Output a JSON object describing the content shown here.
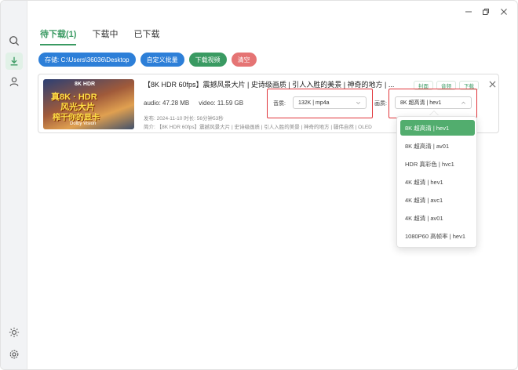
{
  "window_controls": {
    "minimize": "minimize",
    "maximize": "maximize",
    "close": "close"
  },
  "sidebar": {
    "items": [
      {
        "name": "search-icon"
      },
      {
        "name": "download-icon",
        "active": true
      },
      {
        "name": "user-icon"
      },
      {
        "name": "sun-icon"
      },
      {
        "name": "gear-icon"
      }
    ]
  },
  "tabs": [
    {
      "label": "待下载(1)",
      "active": true
    },
    {
      "label": "下载中",
      "active": false
    },
    {
      "label": "已下载",
      "active": false
    }
  ],
  "toolbar": {
    "storage_label": "存储: C:\\Users\\36036\\Desktop",
    "custom_batch_label": "自定义批量",
    "download_video_label": "下载视频",
    "clear_label": "清空"
  },
  "video": {
    "thumb_text_top": "8K HDR",
    "thumb_line1": "真8K · HDR",
    "thumb_line2": "风光大片",
    "thumb_line3": "榨干你的显卡",
    "thumb_brand": "Dolby Vision",
    "title": "【8K HDR 60fps】震撼风景大片 | 史诗级画质 | 引人入胜的美景 | 神奇的地方 | ...",
    "audio_size": "audio: 47.28 MB",
    "video_size": "video: 11.59 GB",
    "published": "发布: 2024-11-10 时长: 56分钟53秒",
    "intro": "简介: 【8K HDR 60fps】震撼风景大片 | 史诗级画质 | 引人入胜的美景 | 神奇的地方 | 疆伟自然 | OLED",
    "cover_btn": "封面",
    "audio_btn": "音频",
    "download_btn": "下载",
    "audio_quality_label": "音质:",
    "audio_quality_value": "132K | mp4a",
    "video_quality_label": "画质:",
    "video_quality_value": "8K 超高清 | hev1"
  },
  "dropdown": {
    "options": [
      {
        "label": "8K 超高清 | hev1",
        "selected": true
      },
      {
        "label": "8K 超高清 | av01",
        "selected": false
      },
      {
        "label": "HDR 真彩色 | hvc1",
        "selected": false
      },
      {
        "label": "4K 超清 | hev1",
        "selected": false
      },
      {
        "label": "4K 超清 | avc1",
        "selected": false
      },
      {
        "label": "4K 超清 | av01",
        "selected": false
      },
      {
        "label": "1080P60 高帧率 | hev1",
        "selected": false
      }
    ]
  },
  "colors": {
    "accent": "#3a9a62",
    "blue": "#2d7fd8",
    "red": "#e57474",
    "highlight": "#e0363b"
  }
}
